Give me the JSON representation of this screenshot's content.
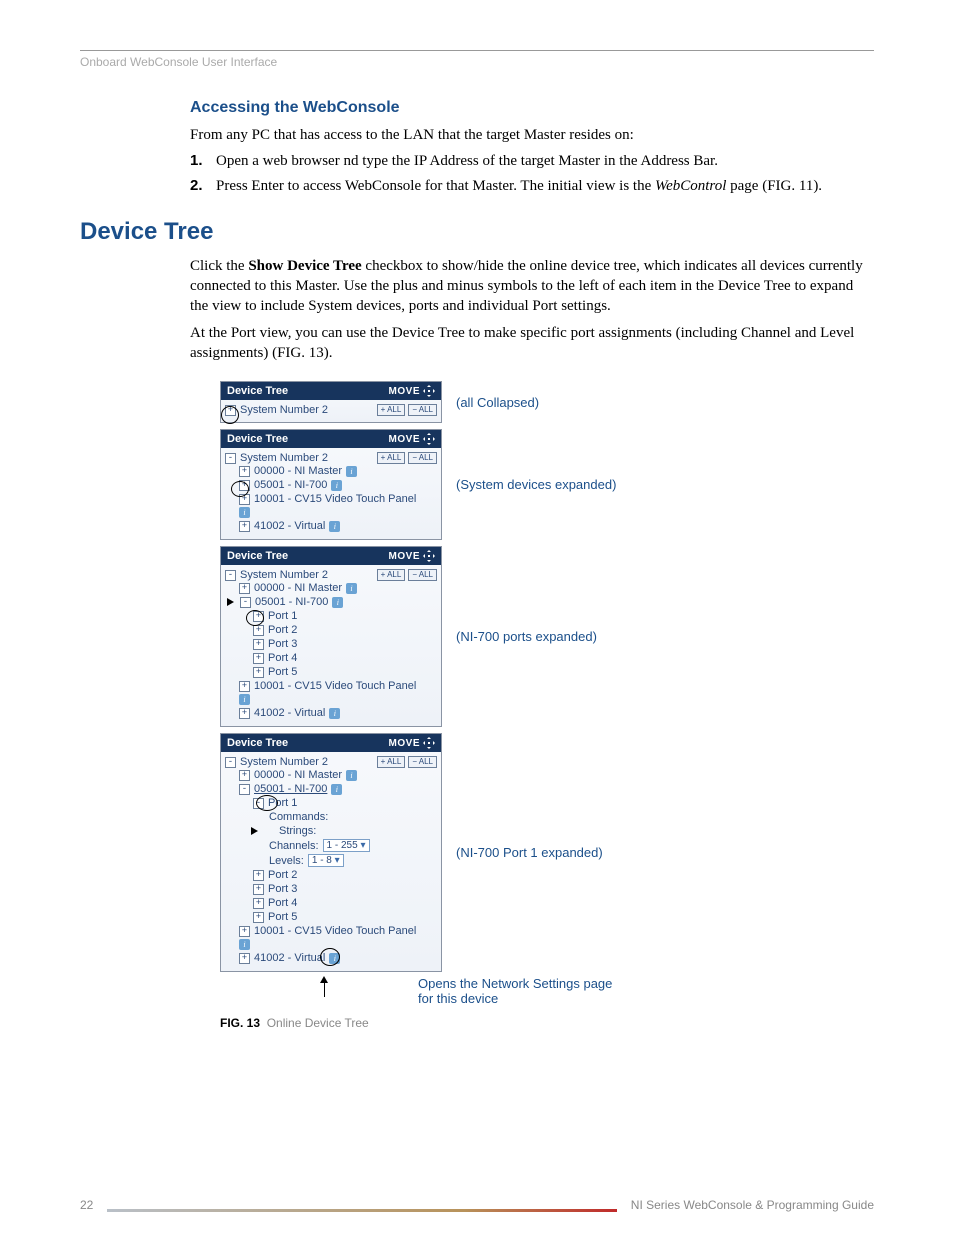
{
  "running_header": "Onboard WebConsole User Interface",
  "section1": {
    "title": "Accessing the WebConsole",
    "intro": "From any PC that has access to the LAN that the target Master resides on:",
    "steps": [
      {
        "n": "1.",
        "text": "Open a web browser nd type the IP Address of the target Master in the Address Bar."
      },
      {
        "n": "2.",
        "pre": "Press Enter to access WebConsole for that Master. The initial view is the ",
        "em": "WebControl",
        "post": " page (FIG. 11)."
      }
    ]
  },
  "section2": {
    "title": "Device Tree",
    "p1_pre": "Click the ",
    "p1_bold": "Show Device Tree",
    "p1_post": " checkbox to show/hide the online device tree, which indicates all devices currently connected to this Master. Use the plus and minus symbols to the left of each item in the Device Tree to expand the view to include System devices, ports and individual Port settings.",
    "p2": "At the Port view, you can use the Device Tree to make specific port assignments (including Channel and Level assignments) (FIG. 13)."
  },
  "panel": {
    "title": "Device Tree",
    "move": "MOVE",
    "plus_all": "+ ALL",
    "minus_all": "− ALL",
    "system": "System Number 2",
    "dev_master": "00000 - NI Master",
    "dev_ni700": "05001 - NI-700",
    "dev_cv15": "10001 - CV15 Video Touch Panel",
    "dev_virtual": "41002 - Virtual",
    "ports": [
      "Port 1",
      "Port 2",
      "Port 3",
      "Port 4",
      "Port 5"
    ],
    "port_detail": {
      "commands": "Commands:",
      "strings": "Strings:",
      "channels_label": "Channels:",
      "channels_value": "1 - 255",
      "levels_label": "Levels:",
      "levels_value": "1 - 8"
    }
  },
  "captions": {
    "c1": "(all Collapsed)",
    "c2": "(System devices expanded)",
    "c3": "(NI-700 ports expanded)",
    "c4": "(NI-700 Port 1 expanded)",
    "note": "Opens the Network Settings page for this device"
  },
  "figcap": {
    "b": "FIG. 13",
    "t": "Online Device Tree"
  },
  "footer": {
    "page": "22",
    "title": "NI Series WebConsole & Programming Guide"
  }
}
